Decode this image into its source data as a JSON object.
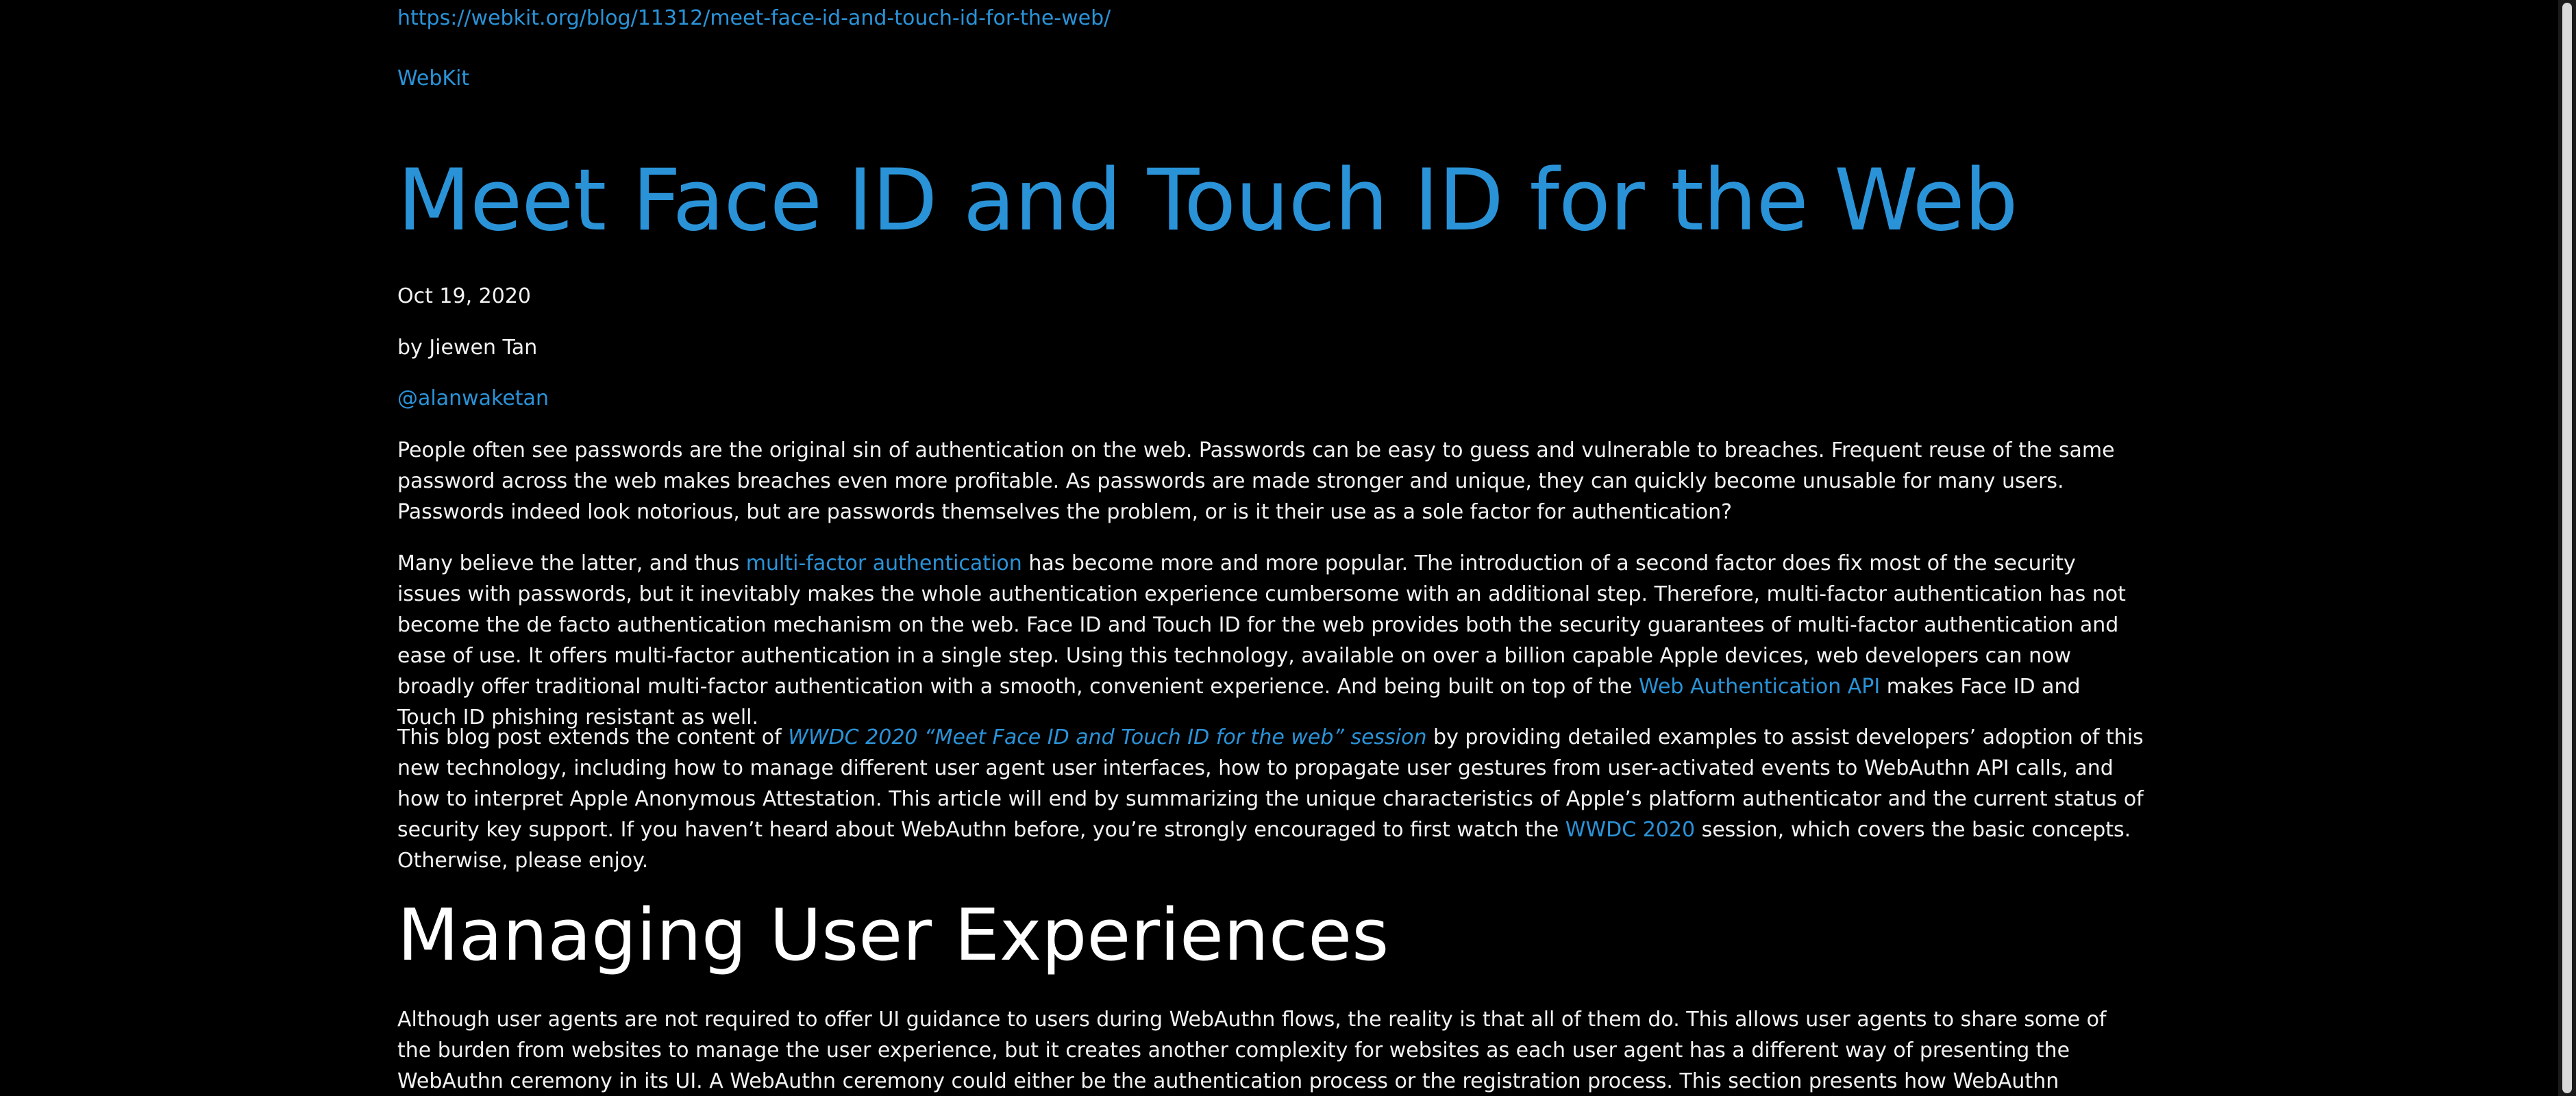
{
  "header": {
    "source_url": "https://webkit.org/blog/11312/meet-face-id-and-touch-id-for-the-web/",
    "site_name": "WebKit"
  },
  "post": {
    "title": "Meet Face ID and Touch ID for the Web",
    "date": "Oct 19, 2020",
    "byline": "by Jiewen Tan",
    "author_handle": "@alanwaketan"
  },
  "body": {
    "p1": "People often see passwords are the original sin of authentication on the web. Passwords can be easy to guess and vulnerable to breaches. Frequent reuse of the same password across the web makes breaches even more profitable. As passwords are made stronger and unique, they can quickly become unusable for many users. Passwords indeed look notorious, but are passwords themselves the problem, or is it their use as a sole factor for authentication?",
    "p2_pre": "Many believe the latter, and thus ",
    "p2_link": "multi-factor authentication",
    "p2_mid": " has become more and more popular. The introduction of a second factor does fix most of the security issues with passwords, but it inevitably makes the whole authentication experience cumbersome with an additional step. Therefore, multi-factor authentication has not become the de facto authentication mechanism on the web. Face ID and Touch ID for the web provides both the security guarantees of multi-factor authentication and ease of use. It offers multi-factor authentication in a single step. Using this technology, available on over a billion capable Apple devices, web developers can now broadly offer traditional multi-factor authentication with a smooth, convenient experience. And being built on top of the ",
    "p2_link2": "Web Authentication API",
    "p2_post": " makes Face ID and Touch ID phishing resistant as well.",
    "p3_pre": "This blog post extends the content of ",
    "p3_link": "WWDC 2020 “Meet Face ID and Touch ID for the web” session",
    "p3_mid": " by providing detailed examples to assist developers’ adoption of this new technology, including how to manage different user agent user interfaces, how to propagate user gestures from user-activated events to WebAuthn API calls, and how to interpret Apple Anonymous Attestation. This article will end by summarizing the unique characteristics of Apple’s platform authenticator and the current status of security key support. If you haven’t heard about WebAuthn before, you’re strongly encouraged to first watch the ",
    "p3_link2": "WWDC 2020",
    "p3_post": " session, which covers the basic concepts. Otherwise, please enjoy.",
    "section_heading": "Managing User Experiences",
    "p4": "Although user agents are not required to offer UI guidance to users during WebAuthn flows, the reality is that all of them do. This allows user agents to share some of the burden from websites to manage the user experience, but it creates another complexity for websites as each user agent has a different way of presenting the WebAuthn ceremony in its UI. A WebAuthn ceremony could either be the authentication process or the registration process. This section presents how WebAuthn ceremony options map to WebKit/Safari’s UI and the recommended"
  },
  "colors": {
    "background": "#000000",
    "text": "#f2f2f2",
    "link": "#2a93d8",
    "heading": "#ffffff"
  }
}
